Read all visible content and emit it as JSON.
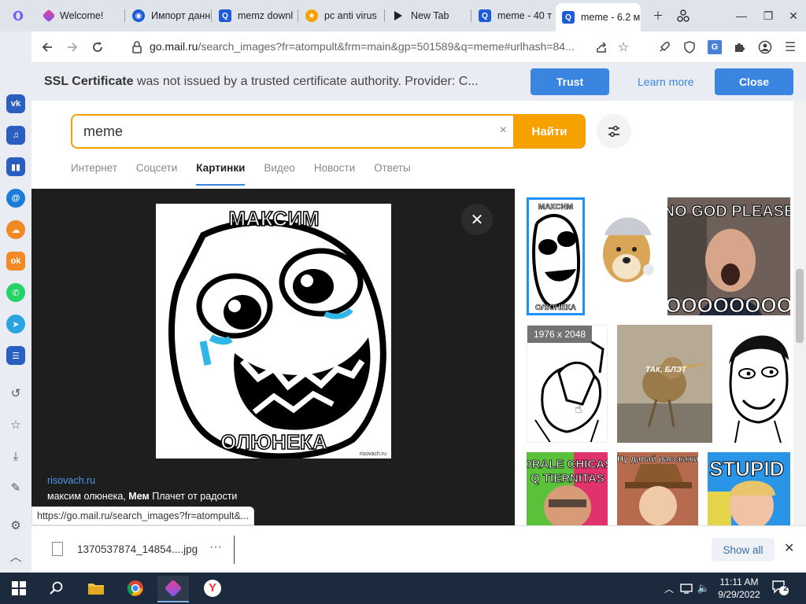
{
  "tabs": [
    {
      "title": "Welcome!",
      "icon": "opera-icon"
    },
    {
      "title": "Импорт данн",
      "icon": "import-icon"
    },
    {
      "title": "memz downl",
      "icon": "mail-search-icon"
    },
    {
      "title": "pc anti virus",
      "icon": "star-icon"
    },
    {
      "title": "New Tab",
      "icon": "new-tab-icon"
    },
    {
      "title": "meme - 40 т",
      "icon": "mail-search-icon"
    },
    {
      "title": "meme - 6.2 м",
      "icon": "mail-search-icon",
      "active": true
    }
  ],
  "address": {
    "domain": "go.mail.ru",
    "path": "/search_images?fr=atompult&frm=main&gp=501589&q=meme#urlhash=84..."
  },
  "ssl": {
    "label": "SSL Certificate",
    "message": " was not issued by a trusted certificate authority. Provider: C...",
    "trust": "Trust",
    "learn_more": "Learn more",
    "close": "Close"
  },
  "search": {
    "query": "meme",
    "clear": "×",
    "button": "Найти"
  },
  "verticals": [
    {
      "label": "Интернет"
    },
    {
      "label": "Соцсети"
    },
    {
      "label": "Картинки",
      "active": true
    },
    {
      "label": "Видео"
    },
    {
      "label": "Новости"
    },
    {
      "label": "Ответы"
    }
  ],
  "viewer": {
    "top_text": "МАКСИМ",
    "bottom_text": "ОЛЮНЕКА",
    "watermark": "risovach.ru",
    "source": "risovach.ru",
    "caption_normal": "максим олюнека, ",
    "caption_bold": "Мем",
    "caption_rest": " Плачет от радости"
  },
  "thumbs": {
    "size_badge": "1976 x 2048",
    "t3_text_top": "NO GOD PLEASE",
    "t3_text_bottom": "OOOOOOOO",
    "t5_text": "ТАК, БЛЭТ",
    "t7_text1": "ORALE CHICAS",
    "t7_text2": "Q TIERNITAS",
    "t8_text": "Ну давай расскажи",
    "t9_text": "STUPID OI",
    "t1_top": "МАКСИМ",
    "t1_bottom": "ОЛЮНЕКА"
  },
  "status_url": "https://go.mail.ru/search_images?fr=atompult&...",
  "download": {
    "filename": "1370537874_14854....jpg",
    "more": "···",
    "show_all": "Show all",
    "close": "✕"
  },
  "taskbar": {
    "time": "11:11 AM",
    "date": "9/29/2022",
    "notifications": "2"
  },
  "colors": {
    "accent_blue": "#3a85e0",
    "search_orange": "#f6a100",
    "viewer_bg": "#1e1e1e",
    "tabstrip_bg": "#dfe3ea"
  }
}
